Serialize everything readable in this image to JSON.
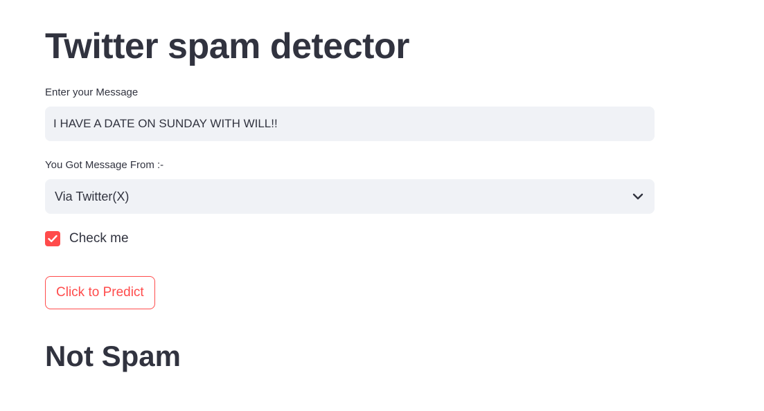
{
  "page": {
    "title": "Twitter spam detector"
  },
  "message_input": {
    "label": "Enter your Message",
    "value": "I HAVE A DATE ON SUNDAY WITH WILL!!"
  },
  "source_select": {
    "label": "You Got Message From :-",
    "selected": "Via Twitter(X)"
  },
  "checkbox": {
    "label": "Check me",
    "checked": true
  },
  "predict_button": {
    "label": "Click to Predict"
  },
  "result": {
    "text": "Not Spam"
  },
  "colors": {
    "accent": "#ff4b4b",
    "text": "#31333f",
    "input_bg": "#f0f2f6"
  },
  "icons": {
    "select": "chevron-down-icon",
    "checkbox": "checkmark-icon"
  }
}
